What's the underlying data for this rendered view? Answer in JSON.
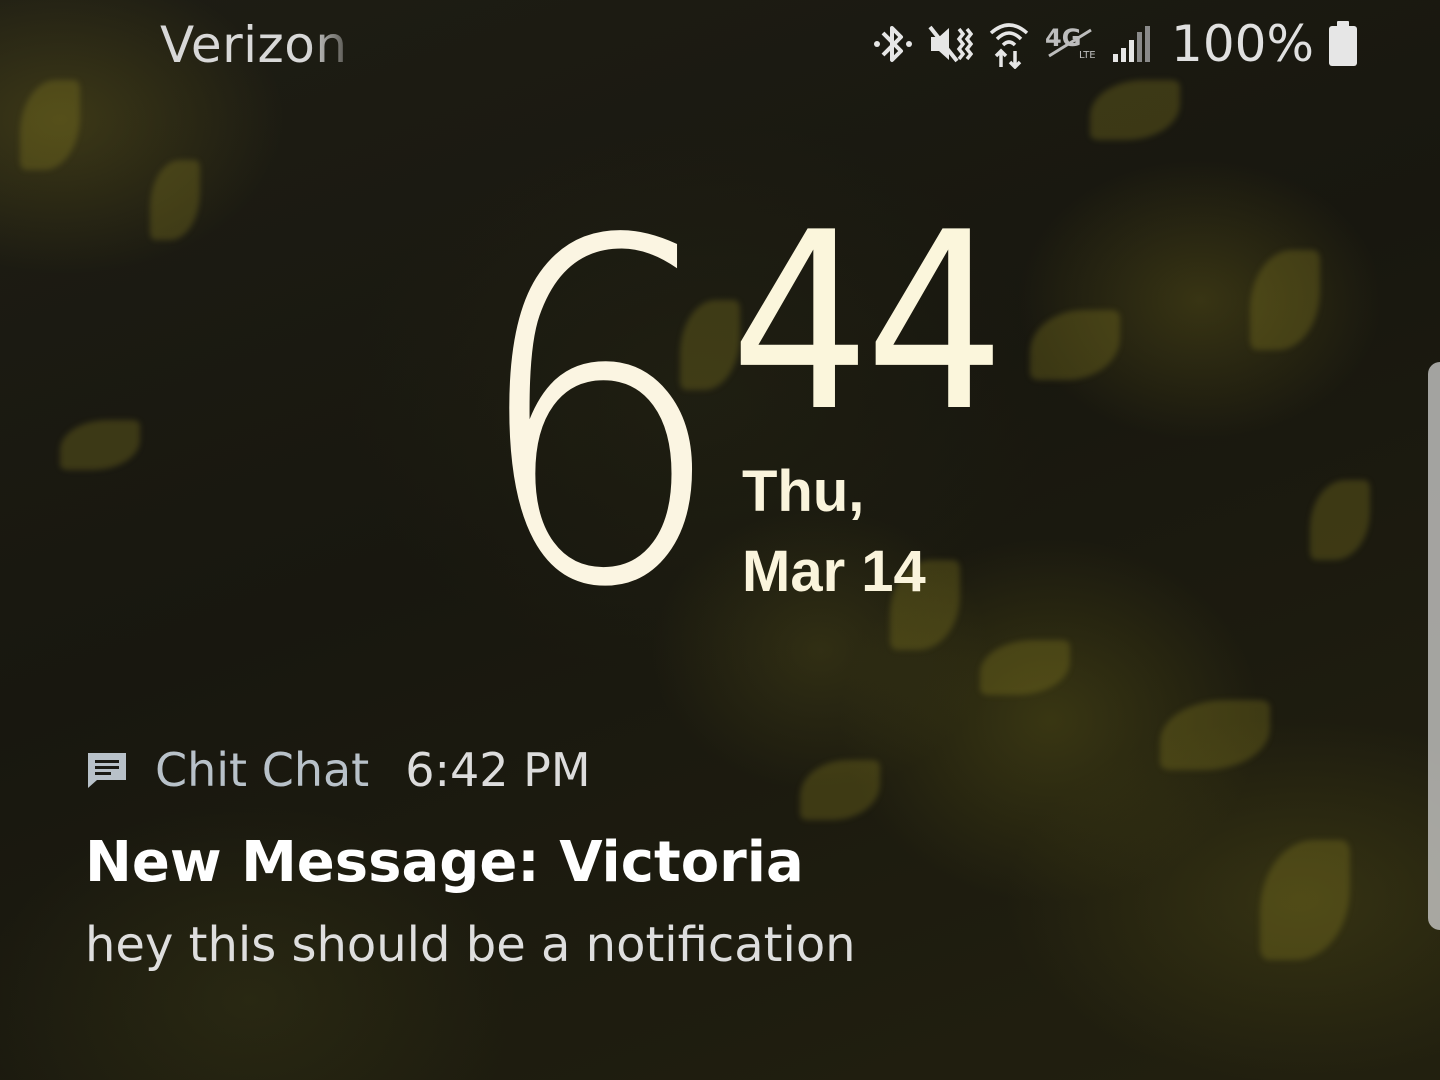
{
  "status_bar": {
    "carrier": "Verizon W",
    "battery_percent": "100%",
    "icons": [
      "bluetooth-icon",
      "vibrate-mute-icon",
      "wifi-calling-icon",
      "4g-lte-icon",
      "signal-icon",
      "battery-icon"
    ]
  },
  "clock": {
    "hour": "6",
    "minutes": "44",
    "day": "Thu,",
    "date": "Mar 14"
  },
  "notification": {
    "app_icon": "message-icon",
    "app_name": "Chit Chat",
    "time": "6:42 PM",
    "title": "New Message: Victoria",
    "body": "hey this should be a notification"
  },
  "colors": {
    "clock": "#fbf5e2",
    "app_name": "#b8c1c9",
    "notification_title": "#ffffff"
  }
}
